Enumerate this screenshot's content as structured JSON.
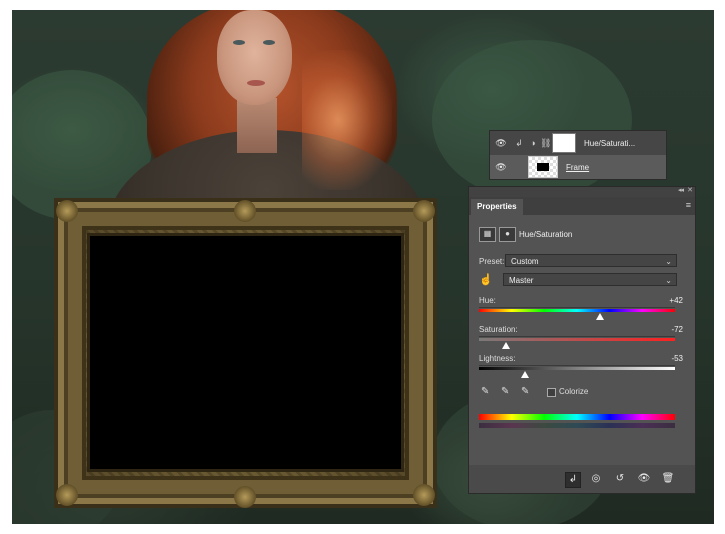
{
  "layers_panel": {
    "rows": [
      {
        "name": "Hue/Saturati...",
        "type": "adjustment"
      },
      {
        "name": "Frame",
        "type": "pixel"
      }
    ]
  },
  "properties": {
    "tab_label": "Properties",
    "adjustment_title": "Hue/Saturation",
    "preset_label": "Preset:",
    "preset_value": "Custom",
    "channel_value": "Master",
    "hue": {
      "label": "Hue:",
      "value": "+42",
      "numeric": 42,
      "min": -180,
      "max": 180
    },
    "saturation": {
      "label": "Saturation:",
      "value": "-72",
      "numeric": -72,
      "min": -100,
      "max": 100
    },
    "lightness": {
      "label": "Lightness:",
      "value": "-53",
      "numeric": -53,
      "min": -100,
      "max": 100
    },
    "colorize_label": "Colorize",
    "colorize_checked": false
  },
  "icons": {
    "collapse": "double-chevron-icon",
    "panel_menu": "hamburger-menu-icon",
    "eye": "visibility-eye-icon",
    "clip": "clip-to-layer-icon",
    "reset": "reset-icon",
    "delete": "trash-icon"
  }
}
